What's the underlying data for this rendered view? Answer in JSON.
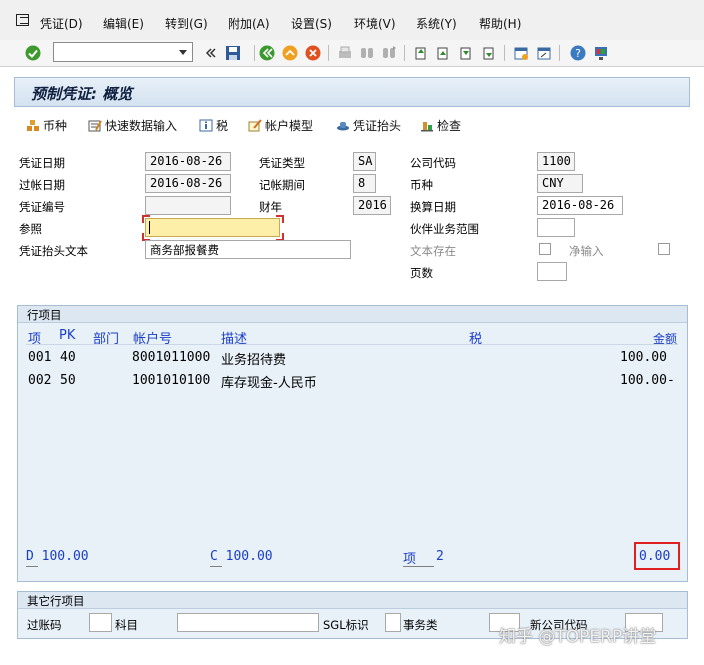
{
  "menubar": {
    "items": [
      "凭证(D)",
      "编辑(E)",
      "转到(G)",
      "附加(A)",
      "设置(S)",
      "环境(V)",
      "系统(Y)",
      "帮助(H)"
    ]
  },
  "toolbar": {
    "command_field": "",
    "icons": [
      "check-icon",
      "back-arrow-icon",
      "save-icon",
      "back-icon",
      "exit-icon",
      "cancel-icon",
      "print-icon",
      "find-icon",
      "find-next-icon",
      "first-page-icon",
      "prev-page-icon",
      "next-page-icon",
      "last-page-icon",
      "new-session-icon",
      "shortcut-icon",
      "help-icon",
      "layout-icon"
    ]
  },
  "title": "预制凭证: 概览",
  "app_toolbar": {
    "currency": "币种",
    "fast_entry": "快速数据输入",
    "tax": "税",
    "account_model": "帐户模型",
    "header": "凭证抬头",
    "check": "检查"
  },
  "form": {
    "doc_date_label": "凭证日期",
    "doc_date": "2016-08-26",
    "doc_type_label": "凭证类型",
    "doc_type": "SA",
    "company_code_label": "公司代码",
    "company_code": "1100",
    "posting_date_label": "过帐日期",
    "posting_date": "2016-08-26",
    "period_label": "记帐期间",
    "period": "8",
    "currency_label": "币种",
    "currency": "CNY",
    "doc_number_label": "凭证编号",
    "doc_number": "",
    "fiscal_year_label": "财年",
    "fiscal_year": "2016",
    "translation_date_label": "换算日期",
    "translation_date": "2016-08-26",
    "reference_label": "参照",
    "reference": "",
    "partner_ba_label": "伙伴业务范围",
    "partner_ba": "",
    "header_text_label": "凭证抬头文本",
    "header_text": "商务部报餐费",
    "text_exists_label": "文本存在",
    "net_entry_label": "净输入",
    "pages_label": "页数",
    "pages": ""
  },
  "line_items": {
    "group_title": "行项目",
    "headers": {
      "item": "项",
      "pk": "PK",
      "dept": "部门",
      "account": "帐户号",
      "desc": "描述",
      "tax": "税",
      "amount": "金额"
    },
    "rows": [
      {
        "item": "001",
        "pk": "40",
        "account": "8001011000",
        "desc": "业务招待费",
        "amount": "100.00"
      },
      {
        "item": "002",
        "pk": "50",
        "account": "1001010100",
        "desc": "库存现金-人民币",
        "amount": "100.00-"
      }
    ],
    "totals": {
      "debit": "D 100.00",
      "credit": "C 100.00",
      "items_label": "项",
      "items": "2",
      "balance": "0.00"
    }
  },
  "other_items": {
    "group_title": "其它行项目",
    "posting_key_label": "过账码",
    "posting_key": "",
    "account_label": "科目",
    "account": "",
    "sgl_label": "SGL标识",
    "sgl": "",
    "trans_type_label": "事务类",
    "trans_type": "",
    "new_company_label": "新公司代码",
    "new_company": ""
  },
  "watermark": "知乎 @TOPERP讲堂",
  "colors": {
    "accent_blue": "#1a3ec8",
    "title_bg": "#d4e2f0",
    "highlight_red": "#e02020"
  }
}
